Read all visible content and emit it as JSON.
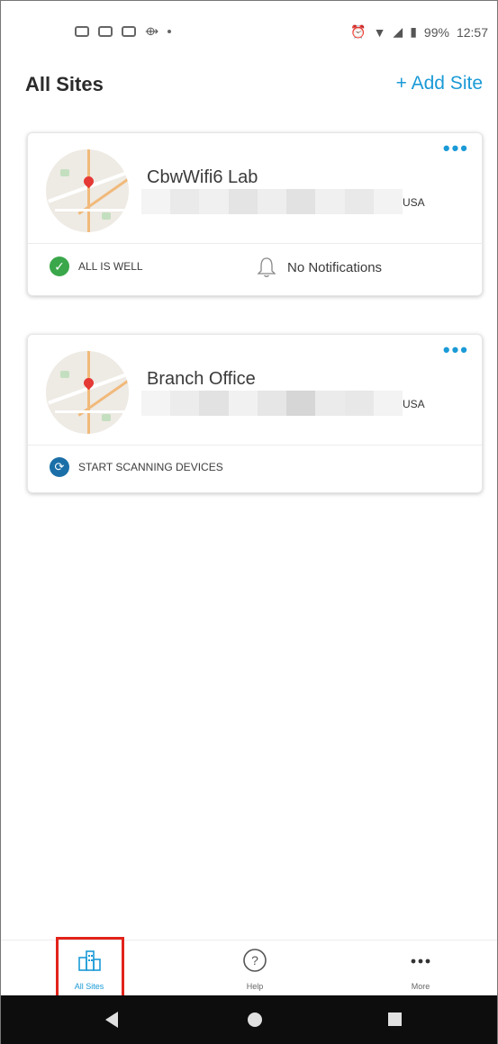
{
  "status_bar": {
    "battery": "99%",
    "time": "12:57"
  },
  "header": {
    "title": "All Sites",
    "add_site_label": "+ Add Site"
  },
  "sites": [
    {
      "name": "CbwWifi6 Lab",
      "country": "USA",
      "menu_label": "•••",
      "health_label": "ALL IS WELL",
      "notifications_label": "No Notifications"
    },
    {
      "name": "Branch Office",
      "country": "USA",
      "menu_label": "•••",
      "scan_label": "START SCANNING DEVICES"
    }
  ],
  "bottom_nav": {
    "items": [
      {
        "label": "All Sites",
        "icon": "buildings-icon",
        "active": true
      },
      {
        "label": "Help",
        "icon": "help-circle-icon",
        "active": false
      },
      {
        "label": "More",
        "icon": "more-dots-icon",
        "active": false
      }
    ]
  },
  "colors": {
    "accent": "#1a9ad6",
    "success": "#3aa74a",
    "scan": "#1b6fa8",
    "highlight": "#e2231a"
  }
}
